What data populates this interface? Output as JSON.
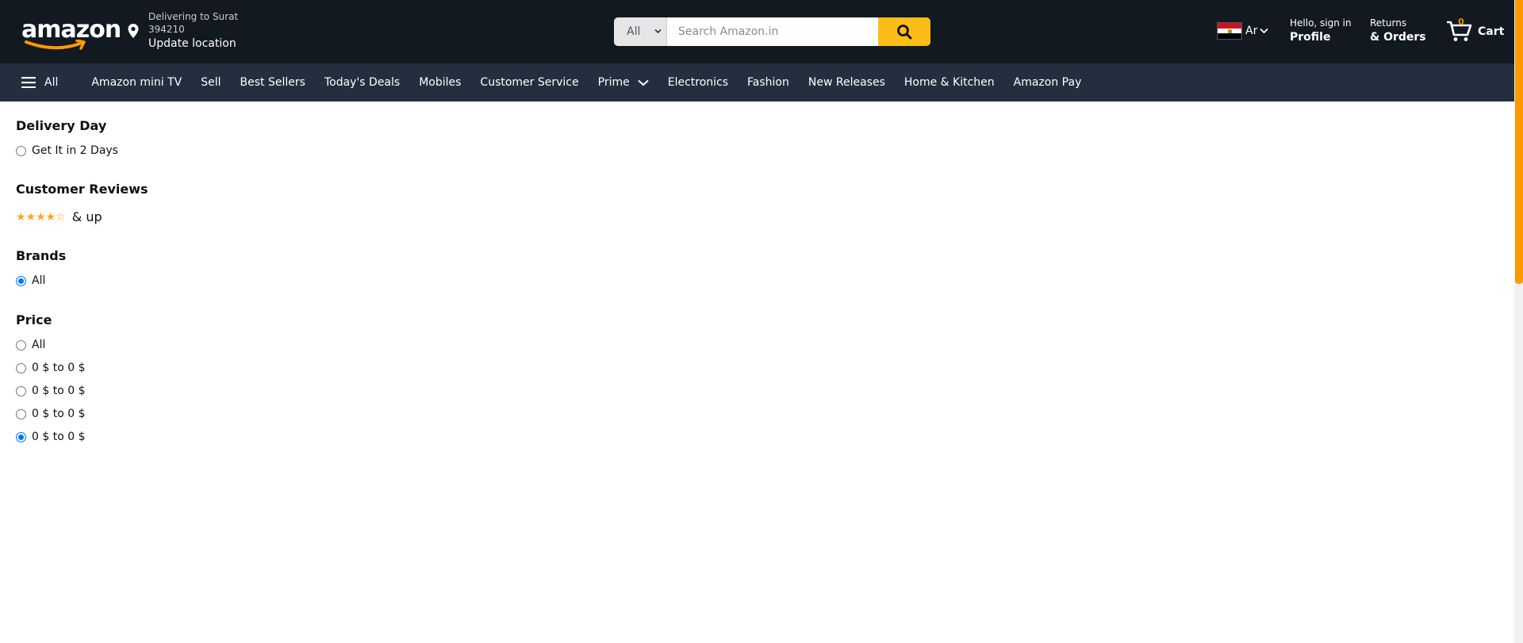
{
  "header": {
    "logo_text": "amazon",
    "location": {
      "line1": "Delivering to Surat",
      "line2": "394210",
      "update_label": "Update location"
    },
    "search": {
      "category": "All",
      "placeholder": "Search Amazon.in"
    },
    "language": {
      "code": "Ar",
      "flag": "egypt-flag-icon"
    },
    "account": {
      "greeting": "Hello, sign in",
      "label": "Profile"
    },
    "orders": {
      "line1": "Returns",
      "line2": "& Orders"
    },
    "cart": {
      "label": "Cart",
      "count": "0"
    }
  },
  "nav": {
    "all_label": "All",
    "items": [
      "Amazon mini TV",
      "Sell",
      "Best Sellers",
      "Today's Deals",
      "Mobiles",
      "Customer Service",
      "Prime",
      "Electronics",
      "Fashion",
      "New Releases",
      "Home & Kitchen",
      "Amazon Pay"
    ]
  },
  "filters": {
    "delivery": {
      "title": "Delivery Day",
      "options": [
        {
          "label": "Get It in 2 Days",
          "selected": false
        }
      ]
    },
    "reviews": {
      "title": "Customer Reviews",
      "stars": "★★★★☆",
      "rating": 4,
      "suffix": "& up"
    },
    "brands": {
      "title": "Brands",
      "options": [
        {
          "label": "All",
          "selected": true
        }
      ]
    },
    "price": {
      "title": "Price",
      "options": [
        {
          "label": "All",
          "selected": false
        },
        {
          "label": "0 $ to 0 $",
          "selected": false
        },
        {
          "label": "0 $ to 0 $",
          "selected": false
        },
        {
          "label": "0 $ to 0 $",
          "selected": false
        },
        {
          "label": "0 $ to 0 $",
          "selected": true
        }
      ]
    }
  },
  "colors": {
    "header_bg": "#131921",
    "nav_bg": "#232f3e",
    "search_button": "#febd16",
    "accent_orange": "#ff9900",
    "star": "#ffa41c",
    "radio_selected": "#0075ff"
  }
}
